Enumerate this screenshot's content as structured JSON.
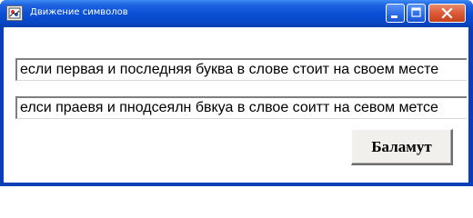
{
  "window": {
    "title": "Движение символов"
  },
  "fields": {
    "original_text": "если первая и последняя буква в слове стоит на своем месте",
    "scrambled_text": "елси праевя и пнодсеялн бвкуа в слвое соитт на севом метсе"
  },
  "buttons": {
    "scramble_label": "Баламут"
  },
  "colors": {
    "titlebar": "#0a4fd6",
    "close_button": "#dc5a35",
    "client_background": "#ffffff",
    "button_face": "#f1f0ec"
  },
  "icons": {
    "app": "app-icon",
    "minimize": "minimize-icon",
    "maximize": "maximize-icon",
    "close": "close-icon"
  }
}
